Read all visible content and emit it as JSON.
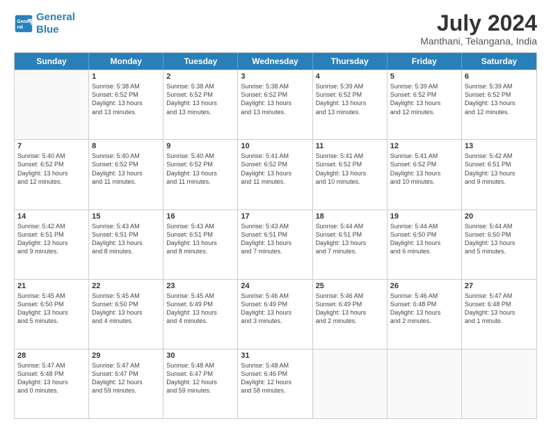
{
  "logo": {
    "line1": "General",
    "line2": "Blue"
  },
  "title": "July 2024",
  "subtitle": "Manthani, Telangana, India",
  "days_of_week": [
    "Sunday",
    "Monday",
    "Tuesday",
    "Wednesday",
    "Thursday",
    "Friday",
    "Saturday"
  ],
  "weeks": [
    [
      {
        "day": "",
        "info": ""
      },
      {
        "day": "1",
        "info": "Sunrise: 5:38 AM\nSunset: 6:52 PM\nDaylight: 13 hours\nand 13 minutes."
      },
      {
        "day": "2",
        "info": "Sunrise: 5:38 AM\nSunset: 6:52 PM\nDaylight: 13 hours\nand 13 minutes."
      },
      {
        "day": "3",
        "info": "Sunrise: 5:38 AM\nSunset: 6:52 PM\nDaylight: 13 hours\nand 13 minutes."
      },
      {
        "day": "4",
        "info": "Sunrise: 5:39 AM\nSunset: 6:52 PM\nDaylight: 13 hours\nand 13 minutes."
      },
      {
        "day": "5",
        "info": "Sunrise: 5:39 AM\nSunset: 6:52 PM\nDaylight: 13 hours\nand 12 minutes."
      },
      {
        "day": "6",
        "info": "Sunrise: 5:39 AM\nSunset: 6:52 PM\nDaylight: 13 hours\nand 12 minutes."
      }
    ],
    [
      {
        "day": "7",
        "info": "Sunrise: 5:40 AM\nSunset: 6:52 PM\nDaylight: 13 hours\nand 12 minutes."
      },
      {
        "day": "8",
        "info": "Sunrise: 5:40 AM\nSunset: 6:52 PM\nDaylight: 13 hours\nand 11 minutes."
      },
      {
        "day": "9",
        "info": "Sunrise: 5:40 AM\nSunset: 6:52 PM\nDaylight: 13 hours\nand 11 minutes."
      },
      {
        "day": "10",
        "info": "Sunrise: 5:41 AM\nSunset: 6:52 PM\nDaylight: 13 hours\nand 11 minutes."
      },
      {
        "day": "11",
        "info": "Sunrise: 5:41 AM\nSunset: 6:52 PM\nDaylight: 13 hours\nand 10 minutes."
      },
      {
        "day": "12",
        "info": "Sunrise: 5:41 AM\nSunset: 6:52 PM\nDaylight: 13 hours\nand 10 minutes."
      },
      {
        "day": "13",
        "info": "Sunrise: 5:42 AM\nSunset: 6:51 PM\nDaylight: 13 hours\nand 9 minutes."
      }
    ],
    [
      {
        "day": "14",
        "info": "Sunrise: 5:42 AM\nSunset: 6:51 PM\nDaylight: 13 hours\nand 9 minutes."
      },
      {
        "day": "15",
        "info": "Sunrise: 5:43 AM\nSunset: 6:51 PM\nDaylight: 13 hours\nand 8 minutes."
      },
      {
        "day": "16",
        "info": "Sunrise: 5:43 AM\nSunset: 6:51 PM\nDaylight: 13 hours\nand 8 minutes."
      },
      {
        "day": "17",
        "info": "Sunrise: 5:43 AM\nSunset: 6:51 PM\nDaylight: 13 hours\nand 7 minutes."
      },
      {
        "day": "18",
        "info": "Sunrise: 5:44 AM\nSunset: 6:51 PM\nDaylight: 13 hours\nand 7 minutes."
      },
      {
        "day": "19",
        "info": "Sunrise: 5:44 AM\nSunset: 6:50 PM\nDaylight: 13 hours\nand 6 minutes."
      },
      {
        "day": "20",
        "info": "Sunrise: 5:44 AM\nSunset: 6:50 PM\nDaylight: 13 hours\nand 5 minutes."
      }
    ],
    [
      {
        "day": "21",
        "info": "Sunrise: 5:45 AM\nSunset: 6:50 PM\nDaylight: 13 hours\nand 5 minutes."
      },
      {
        "day": "22",
        "info": "Sunrise: 5:45 AM\nSunset: 6:50 PM\nDaylight: 13 hours\nand 4 minutes."
      },
      {
        "day": "23",
        "info": "Sunrise: 5:45 AM\nSunset: 6:49 PM\nDaylight: 13 hours\nand 4 minutes."
      },
      {
        "day": "24",
        "info": "Sunrise: 5:46 AM\nSunset: 6:49 PM\nDaylight: 13 hours\nand 3 minutes."
      },
      {
        "day": "25",
        "info": "Sunrise: 5:46 AM\nSunset: 6:49 PM\nDaylight: 13 hours\nand 2 minutes."
      },
      {
        "day": "26",
        "info": "Sunrise: 5:46 AM\nSunset: 6:48 PM\nDaylight: 13 hours\nand 2 minutes."
      },
      {
        "day": "27",
        "info": "Sunrise: 5:47 AM\nSunset: 6:48 PM\nDaylight: 13 hours\nand 1 minute."
      }
    ],
    [
      {
        "day": "28",
        "info": "Sunrise: 5:47 AM\nSunset: 6:48 PM\nDaylight: 13 hours\nand 0 minutes."
      },
      {
        "day": "29",
        "info": "Sunrise: 5:47 AM\nSunset: 6:47 PM\nDaylight: 12 hours\nand 59 minutes."
      },
      {
        "day": "30",
        "info": "Sunrise: 5:48 AM\nSunset: 6:47 PM\nDaylight: 12 hours\nand 59 minutes."
      },
      {
        "day": "31",
        "info": "Sunrise: 5:48 AM\nSunset: 6:46 PM\nDaylight: 12 hours\nand 58 minutes."
      },
      {
        "day": "",
        "info": ""
      },
      {
        "day": "",
        "info": ""
      },
      {
        "day": "",
        "info": ""
      }
    ]
  ]
}
